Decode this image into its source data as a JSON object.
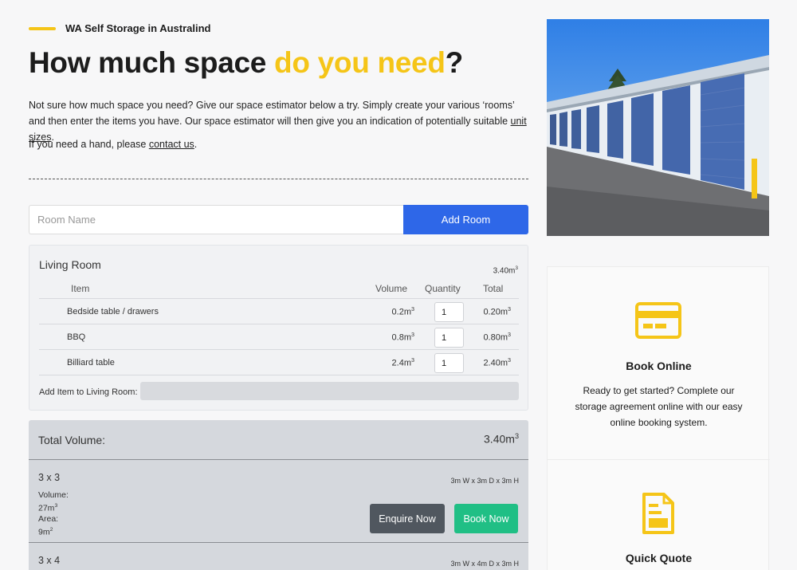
{
  "eyebrow": "WA Self Storage in Australind",
  "headline": {
    "part1": "How much space ",
    "highlight": "do you need",
    "part2": "?"
  },
  "intro": {
    "text": "Not sure how much space you need? Give our space estimator below a try. Simply create your various ‘rooms’ and then enter the items you have. Our space estimator will then give you an indication of potentially suitable ",
    "link": "unit sizes",
    "end": "."
  },
  "help": {
    "text": "If you need a hand, please ",
    "link": "contact us",
    "end": "."
  },
  "room_form": {
    "placeholder": "Room Name",
    "button": "Add Room"
  },
  "room": {
    "name": "Living Room",
    "total": "3.40m",
    "headers": {
      "item": "Item",
      "volume": "Volume",
      "quantity": "Quantity",
      "total": "Total"
    },
    "items": [
      {
        "name": "Bedside table / drawers",
        "volume": "0.2m",
        "qty": "1",
        "total": "0.20m"
      },
      {
        "name": "BBQ",
        "volume": "0.8m",
        "qty": "1",
        "total": "0.80m"
      },
      {
        "name": "Billiard table",
        "volume": "2.4m",
        "qty": "1",
        "total": "2.40m"
      }
    ],
    "add_item_label": "Add Item to Living Room:"
  },
  "summary": {
    "total_label": "Total Volume:",
    "total_value": "3.40m",
    "units": [
      {
        "title": "3 x 3",
        "dims": "3m W x 3m D x 3m H",
        "volume_label": "Volume:",
        "volume": "27m",
        "area_label": "Area:",
        "area": "9m"
      },
      {
        "title": "3 x 4",
        "dims": "3m W x 4m D x 3m H"
      }
    ],
    "enquire": "Enquire Now",
    "book": "Book Now"
  },
  "sidebar": {
    "book_online": {
      "title": "Book Online",
      "text": "Ready to get started? Complete our storage agreement online with our easy online booking system."
    },
    "quick_quote": {
      "title": "Quick Quote"
    }
  },
  "colors": {
    "accent": "#f5c518",
    "primary": "#2e67e8",
    "success": "#20bf85",
    "dark": "#50575f"
  },
  "icons": [
    "card-icon",
    "document-icon"
  ]
}
